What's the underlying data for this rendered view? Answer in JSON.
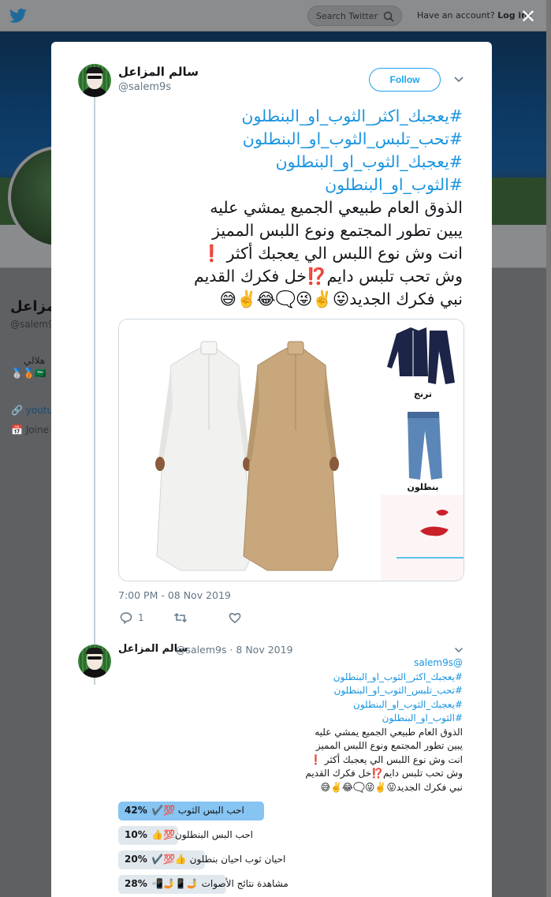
{
  "topbar": {
    "search_placeholder": "Search Twitter",
    "account_prompt": "Have an account?",
    "login_label": "Log in"
  },
  "background_profile": {
    "name_partial": "لمزاعل",
    "handle_partial": "@salem9",
    "bio_partial": "هلالي",
    "bio_emoji": "🥈🥉🇸🇦",
    "link_partial": "youtul",
    "joined_partial": "Joine"
  },
  "close_icon": "✕",
  "tweet": {
    "author_name": "سالم المزاعل",
    "author_handle": "@salem9s",
    "follow_label": "Follow",
    "hashtags": [
      "#يعجبك_اكثر_الثوب_او_البنطلون",
      "#تحب_تلبس_الثوب_او_البنطلون",
      "#يعجبك_الثوب_او_البنطلون",
      "#الثوب_او_البنطلون"
    ],
    "lines": [
      "الذوق العام طبيعي الجميع يمشي عليه",
      "يبين تطور المجتمع ونوع اللبس المميز",
      "انت وش نوع اللبس الي يعجبك أكثر ❗",
      "وش تحب تلبس دايم⁉️خل فكرك القديم",
      "نبي فكرك الجديد😛✌️😜🗨️😂✌️😅"
    ],
    "media_captions": [
      "ترنج",
      "بنطلون"
    ],
    "timestamp": "7:00 PM - 08 Nov 2019",
    "reply_count": "1"
  },
  "reply": {
    "author_name": "سالم المزاعل",
    "author_handle": "@salem9s · 8 Nov 2019",
    "mention": "@salem9s",
    "hashtags": [
      "#يعجبك_اكثر_الثوب_او_البنطلون",
      "#تحب_تلبس_الثوب_او_البنطلون",
      "#يعجبك_الثوب_او_البنطلون",
      "#الثوب_او_البنطلون"
    ],
    "lines": [
      "الذوق العام طبيعي الجميع يمشي عليه",
      "يبين تطور المجتمع ونوع اللبس المميز",
      "انت وش نوع اللبس الي يعجبك أكثر ❗",
      "وش تحب تلبس دايم⁉️خل فكرك القديم",
      "نبي فكرك الجديد😛✌️😜🗨️😂✌️😅"
    ],
    "poll": [
      {
        "pct_text": "42%",
        "pct": 42,
        "label": "احب البس الثوب 💯✔️",
        "winner": true
      },
      {
        "pct_text": "10%",
        "pct": 10,
        "label": "احب البس البنطلون💯👍",
        "winner": false
      },
      {
        "pct_text": "20%",
        "pct": 20,
        "label": "احيان ثوب احيان بنطلون 👍💯✔️",
        "winner": false
      },
      {
        "pct_text": "28%",
        "pct": 28,
        "label": "مشاهدة نتائج الأصوات 🤳📱🤳📲",
        "winner": false
      }
    ]
  },
  "colors": {
    "accent": "#1da1f2",
    "link": "#1b95e0",
    "poll_winner": "#86c4f2",
    "poll_other": "#e1e8ed"
  }
}
